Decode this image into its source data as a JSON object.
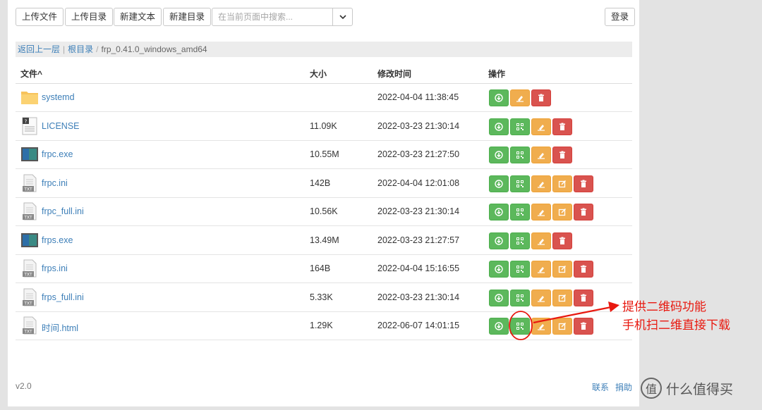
{
  "toolbar": {
    "upload_file": "上传文件",
    "upload_dir": "上传目录",
    "new_text": "新建文本",
    "new_dir": "新建目录",
    "search_placeholder": "在当前页面中搜索...",
    "login": "登录"
  },
  "breadcrumb": {
    "back": "返回上一层",
    "root": "根目录",
    "sep": "|",
    "sep2": "/",
    "current": "frp_0.41.0_windows_amd64"
  },
  "table": {
    "headers": {
      "name": "文件^",
      "size": "大小",
      "mtime": "修改时间",
      "actions": "操作"
    },
    "rows": [
      {
        "name": "systemd",
        "size": "",
        "mtime": "2022-04-04 11:38:45",
        "icon": "folder-icon",
        "actions": [
          "download",
          "move",
          "delete"
        ]
      },
      {
        "name": "LICENSE",
        "size": "11.09K",
        "mtime": "2022-03-23 21:30:14",
        "icon": "unknown-file-icon",
        "actions": [
          "download",
          "qrcode",
          "move",
          "delete"
        ]
      },
      {
        "name": "frpc.exe",
        "size": "10.55M",
        "mtime": "2022-03-23 21:27:50",
        "icon": "exe-file-icon",
        "actions": [
          "download",
          "qrcode",
          "move",
          "delete"
        ]
      },
      {
        "name": "frpc.ini",
        "size": "142B",
        "mtime": "2022-04-04 12:01:08",
        "icon": "txt-file-icon",
        "actions": [
          "download",
          "qrcode",
          "move",
          "edit",
          "delete"
        ]
      },
      {
        "name": "frpc_full.ini",
        "size": "10.56K",
        "mtime": "2022-03-23 21:30:14",
        "icon": "txt-file-icon",
        "actions": [
          "download",
          "qrcode",
          "move",
          "edit",
          "delete"
        ]
      },
      {
        "name": "frps.exe",
        "size": "13.49M",
        "mtime": "2022-03-23 21:27:57",
        "icon": "exe-file-icon",
        "actions": [
          "download",
          "qrcode",
          "move",
          "delete"
        ]
      },
      {
        "name": "frps.ini",
        "size": "164B",
        "mtime": "2022-04-04 15:16:55",
        "icon": "txt-file-icon",
        "actions": [
          "download",
          "qrcode",
          "move",
          "edit",
          "delete"
        ]
      },
      {
        "name": "frps_full.ini",
        "size": "5.33K",
        "mtime": "2022-03-23 21:30:14",
        "icon": "txt-file-icon",
        "actions": [
          "download",
          "qrcode",
          "move",
          "edit",
          "delete"
        ]
      },
      {
        "name": "时间.html",
        "size": "1.29K",
        "mtime": "2022-06-07 14:01:15",
        "icon": "txt-file-icon",
        "actions": [
          "download",
          "qrcode",
          "move",
          "edit",
          "delete"
        ]
      }
    ]
  },
  "footer": {
    "version": "v2.0",
    "contact": "联系",
    "donate": "捐助"
  },
  "annotation": {
    "line1": "提供二维码功能",
    "line2": "手机扫二维直接下载",
    "color": "#e8180f"
  },
  "watermark": {
    "text": "什么值得买",
    "logo_char": "值"
  },
  "colors": {
    "link": "#3d7fb8",
    "success": "#5cb85c",
    "warning": "#f0ad4e",
    "danger": "#d9534f"
  }
}
